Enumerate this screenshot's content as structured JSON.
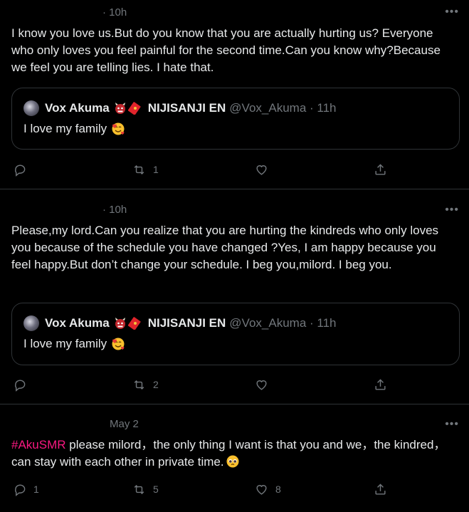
{
  "tweets": [
    {
      "time": "· 10h",
      "text": "I know you love us.But do you know that you are actually hurting us? Everyone who only loves you feel painful for the second time.Can you know why?Because we feel you are telling lies. I hate that.",
      "quote": {
        "name": "Vox Akuma",
        "org": "NIJISANJI EN",
        "handle": "@Vox_Akuma · 11h",
        "text": "I love my family"
      },
      "replies": "",
      "retweets": "1",
      "likes": ""
    },
    {
      "time": "· 10h",
      "text": "Please,my lord.Can you realize that you are hurting the kindreds who only loves you because of the schedule you have changed ?Yes, I am happy because you feel happy.But don’t change your schedule. I beg you,milord. I beg you.",
      "quote": {
        "name": "Vox Akuma",
        "org": "NIJISANJI EN",
        "handle": "@Vox_Akuma · 11h",
        "text": "I love my family"
      },
      "replies": "",
      "retweets": "2",
      "likes": ""
    },
    {
      "time": "May 2",
      "hashtag": "#AkuSMR",
      "text": " please milord，the only thing I want is that you and we，the kindred，can stay with each other in private time.",
      "replies": "1",
      "retweets": "5",
      "likes": "8"
    }
  ],
  "more_label": "•••",
  "colors": {
    "background": "#000000",
    "text": "#e7e9ea",
    "muted": "#71767b",
    "hashtag": "#f91880",
    "border": "#2f3336"
  },
  "icons": [
    "reply-icon",
    "retweet-icon",
    "like-icon",
    "share-icon",
    "more-icon",
    "ogre-emoji",
    "red-envelope-emoji",
    "smiling-face-with-hearts-emoji",
    "pleading-face-emoji"
  ]
}
